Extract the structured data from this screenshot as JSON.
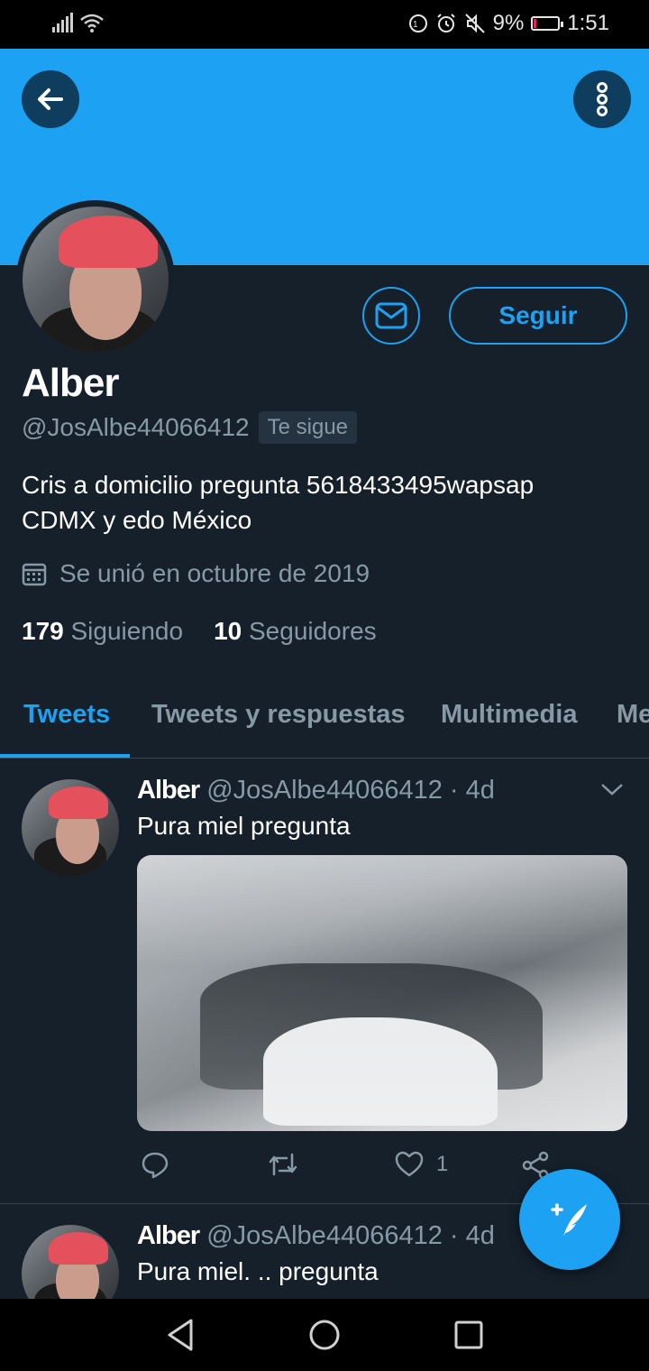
{
  "status_bar": {
    "battery": "9%",
    "time": "1:51"
  },
  "header": {
    "back_icon": "arrow-left-icon",
    "more_icon": "more-vertical-icon"
  },
  "profile": {
    "display_name": "Alber",
    "handle": "@JosAlbe44066412",
    "follows_you": "Te sigue",
    "bio_line1": "Cris a domicilio pregunta 5618433495wapsap",
    "bio_line2": "CDMX y edo México",
    "joined": "Se unió en octubre de 2019",
    "following_count": "179",
    "following_label": "Siguiendo",
    "followers_count": "10",
    "followers_label": "Seguidores",
    "message_icon": "mail-icon",
    "follow_label": "Seguir"
  },
  "tabs": [
    {
      "label": "Tweets"
    },
    {
      "label": "Tweets y respuestas"
    },
    {
      "label": "Multimedia"
    },
    {
      "label": "Me"
    }
  ],
  "tweets": [
    {
      "name": "Alber",
      "handle": "@JosAlbe44066412",
      "time": "· 4d",
      "text": "Pura miel pregunta",
      "likes": "1"
    },
    {
      "name": "Alber",
      "handle": "@JosAlbe44066412",
      "time": "· 4d",
      "text": "Pura miel. .. pregunta"
    }
  ],
  "colors": {
    "accent": "#1da1f2",
    "background": "#15202b",
    "secondary_text": "#8899a6"
  }
}
